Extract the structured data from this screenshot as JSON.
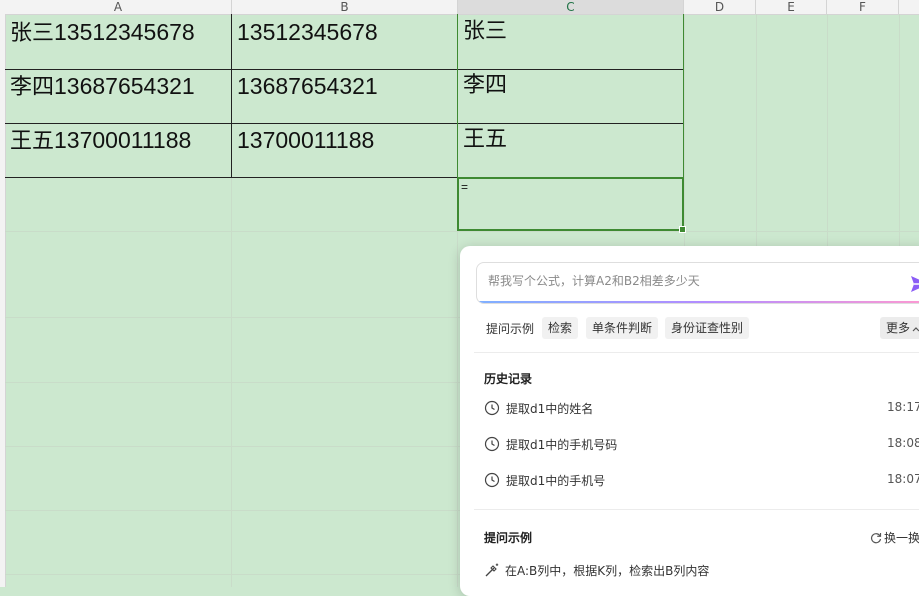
{
  "columns": [
    "A",
    "B",
    "C",
    "D",
    "E",
    "F"
  ],
  "rows": [
    {
      "a_name": "张三",
      "a_phone": "13512345678",
      "b": "13512345678",
      "c": "张三"
    },
    {
      "a_name": "李四",
      "a_phone": "13687654321",
      "b": "13687654321",
      "c": "李四"
    },
    {
      "a_name": "王五",
      "a_phone": "13700011188",
      "b": "13700011188",
      "c": "王五"
    }
  ],
  "active_cell": {
    "column": "C",
    "value": "="
  },
  "assistant": {
    "prompt_placeholder": "帮我写个公式，计算A2和B2相差多少天",
    "examples_label": "提问示例",
    "chips": [
      "检索",
      "单条件判断",
      "身份证查性别"
    ],
    "more_label": "更多",
    "history_title": "历史记录",
    "history": [
      {
        "text": "提取d1中的姓名",
        "time": "18:17"
      },
      {
        "text": "提取d1中的手机号码",
        "time": "18:08"
      },
      {
        "text": "提取d1中的手机号",
        "time": "18:07"
      }
    ],
    "examples_title": "提问示例",
    "refresh_label": "换一换",
    "example_item": "在A:B列中，根据K列，检索出B列内容"
  },
  "colors": {
    "sheet_background": "#cce8cf",
    "selection_border": "#3e8a32",
    "send_icon": "#8b5cf6"
  },
  "icons": [
    "send-icon",
    "clock-icon",
    "refresh-icon",
    "magic-wand-icon",
    "chevron-up-icon"
  ]
}
